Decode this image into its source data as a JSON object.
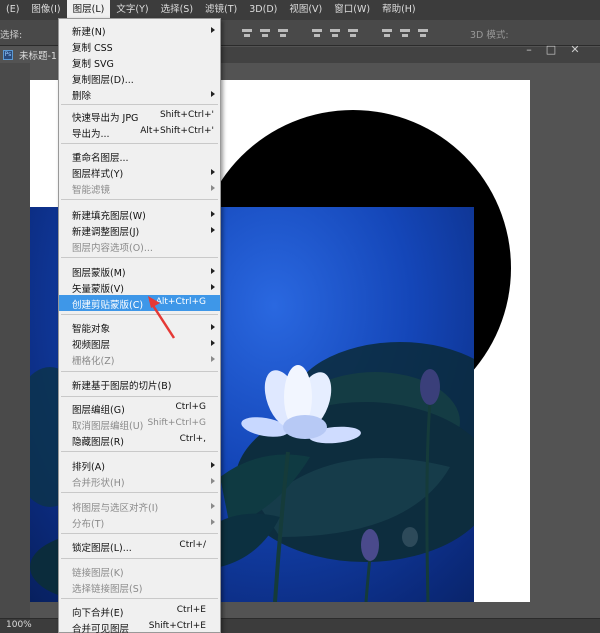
{
  "menubar": {
    "items": [
      {
        "label": "(E)"
      },
      {
        "label": "图像(I)"
      },
      {
        "label": "图层(L)"
      },
      {
        "label": "文字(Y)"
      },
      {
        "label": "选择(S)"
      },
      {
        "label": "滤镜(T)"
      },
      {
        "label": "3D(D)"
      },
      {
        "label": "视图(V)"
      },
      {
        "label": "窗口(W)"
      },
      {
        "label": "帮助(H)"
      }
    ]
  },
  "options": {
    "label": "选择:",
    "mode_3d": "3D 模式:"
  },
  "document": {
    "tab_title": "未标题-1"
  },
  "status": {
    "zoom": "100%"
  },
  "layer_menu": {
    "items": [
      {
        "label": "新建(N)",
        "shortcut": "",
        "submenu": true,
        "disabled": false
      },
      {
        "label": "复制 CSS",
        "shortcut": "",
        "submenu": false,
        "disabled": false
      },
      {
        "label": "复制 SVG",
        "shortcut": "",
        "submenu": false,
        "disabled": false
      },
      {
        "label": "复制图层(D)...",
        "shortcut": "",
        "submenu": false,
        "disabled": false
      },
      {
        "label": "删除",
        "shortcut": "",
        "submenu": true,
        "disabled": false
      },
      {
        "label": "快速导出为 JPG",
        "shortcut": "Shift+Ctrl+'",
        "submenu": false,
        "disabled": false
      },
      {
        "label": "导出为...",
        "shortcut": "Alt+Shift+Ctrl+'",
        "submenu": false,
        "disabled": false
      },
      {
        "label": "重命名图层...",
        "shortcut": "",
        "submenu": false,
        "disabled": false
      },
      {
        "label": "图层样式(Y)",
        "shortcut": "",
        "submenu": true,
        "disabled": false
      },
      {
        "label": "智能滤镜",
        "shortcut": "",
        "submenu": true,
        "disabled": true
      },
      {
        "label": "新建填充图层(W)",
        "shortcut": "",
        "submenu": true,
        "disabled": false
      },
      {
        "label": "新建调整图层(J)",
        "shortcut": "",
        "submenu": true,
        "disabled": false
      },
      {
        "label": "图层内容选项(O)...",
        "shortcut": "",
        "submenu": false,
        "disabled": true
      },
      {
        "label": "图层蒙版(M)",
        "shortcut": "",
        "submenu": true,
        "disabled": false
      },
      {
        "label": "矢量蒙版(V)",
        "shortcut": "",
        "submenu": true,
        "disabled": false
      },
      {
        "label": "创建剪贴蒙版(C)",
        "shortcut": "Alt+Ctrl+G",
        "submenu": false,
        "disabled": false,
        "highlighted": true
      },
      {
        "label": "智能对象",
        "shortcut": "",
        "submenu": true,
        "disabled": false
      },
      {
        "label": "视频图层",
        "shortcut": "",
        "submenu": true,
        "disabled": false
      },
      {
        "label": "栅格化(Z)",
        "shortcut": "",
        "submenu": true,
        "disabled": true
      },
      {
        "label": "新建基于图层的切片(B)",
        "shortcut": "",
        "submenu": false,
        "disabled": false
      },
      {
        "label": "图层编组(G)",
        "shortcut": "Ctrl+G",
        "submenu": false,
        "disabled": false
      },
      {
        "label": "取消图层编组(U)",
        "shortcut": "Shift+Ctrl+G",
        "submenu": false,
        "disabled": true
      },
      {
        "label": "隐藏图层(R)",
        "shortcut": "Ctrl+,",
        "submenu": false,
        "disabled": false
      },
      {
        "label": "排列(A)",
        "shortcut": "",
        "submenu": true,
        "disabled": false
      },
      {
        "label": "合并形状(H)",
        "shortcut": "",
        "submenu": true,
        "disabled": true
      },
      {
        "label": "将图层与选区对齐(I)",
        "shortcut": "",
        "submenu": true,
        "disabled": true
      },
      {
        "label": "分布(T)",
        "shortcut": "",
        "submenu": true,
        "disabled": true
      },
      {
        "label": "锁定图层(L)...",
        "shortcut": "Ctrl+/",
        "submenu": false,
        "disabled": false
      },
      {
        "label": "链接图层(K)",
        "shortcut": "",
        "submenu": false,
        "disabled": true
      },
      {
        "label": "选择链接图层(S)",
        "shortcut": "",
        "submenu": false,
        "disabled": true
      },
      {
        "label": "向下合并(E)",
        "shortcut": "Ctrl+E",
        "submenu": false,
        "disabled": false
      },
      {
        "label": "合并可见图层",
        "shortcut": "Shift+Ctrl+E",
        "submenu": false,
        "disabled": false
      }
    ]
  },
  "colors": {
    "highlight": "#3e97e8",
    "annotation": "#e53935"
  }
}
